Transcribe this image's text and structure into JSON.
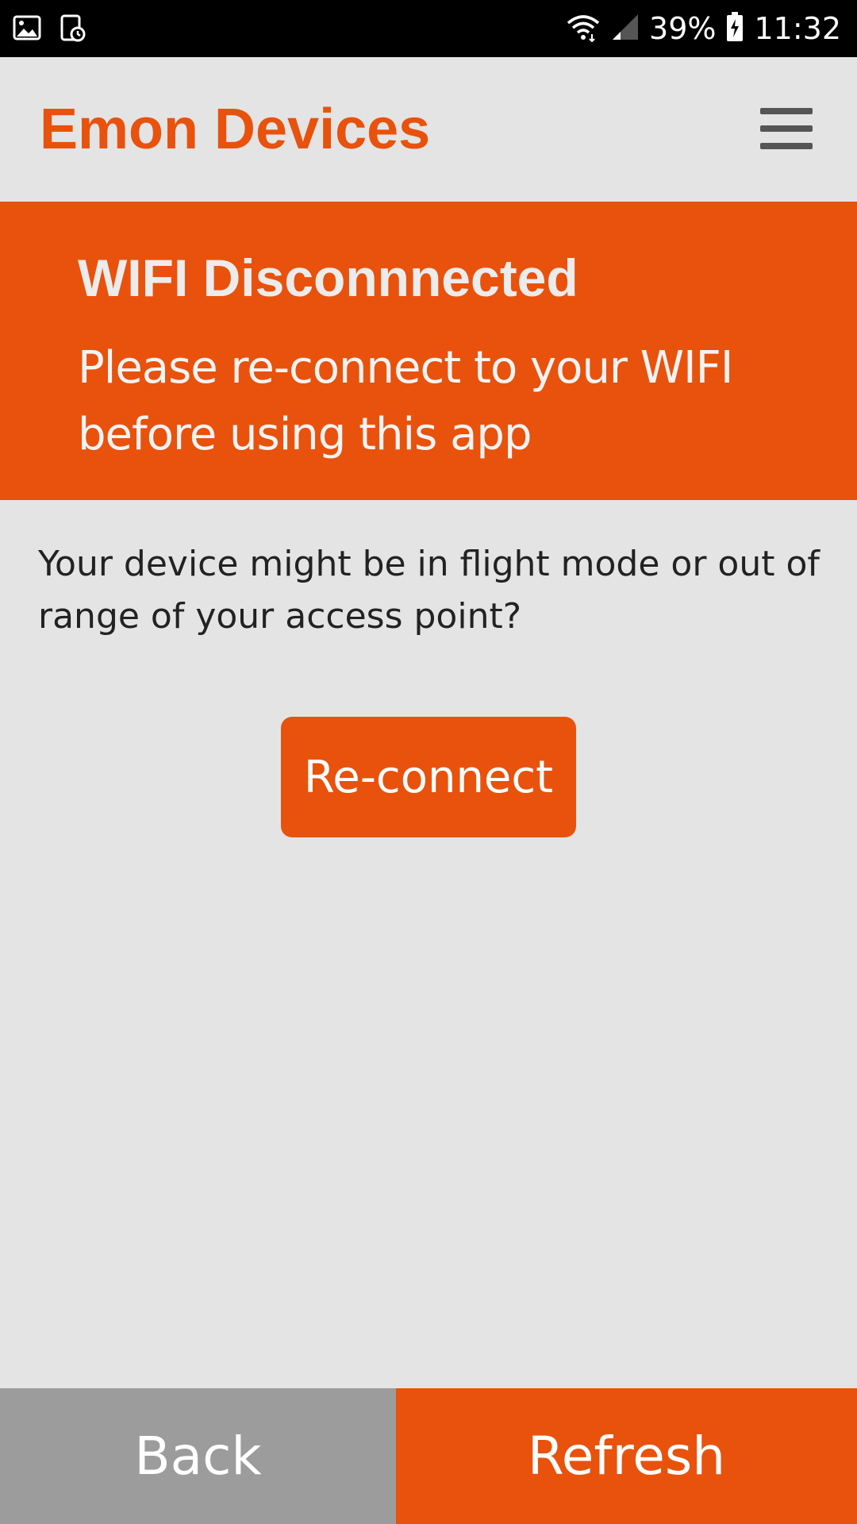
{
  "status_bar": {
    "battery": "39%",
    "time": "11:32",
    "icons": [
      "gallery-icon",
      "screenshot-icon",
      "wifi-icon",
      "signal-icon",
      "battery-icon"
    ]
  },
  "header": {
    "title": "Emon Devices",
    "menu_icon": "hamburger-menu-icon"
  },
  "banner": {
    "title": "WIFI Disconnnected",
    "message": "Please re-connect to your WIFI before using this app"
  },
  "main": {
    "info": "Your device might be in flight mode or out of range of your access point?",
    "reconnect_label": "Re-connect"
  },
  "bottom_bar": {
    "back_label": "Back",
    "refresh_label": "Refresh"
  },
  "colors": {
    "accent": "#e8520d",
    "background": "#e4e4e4",
    "back_button": "#9c9c9c"
  }
}
